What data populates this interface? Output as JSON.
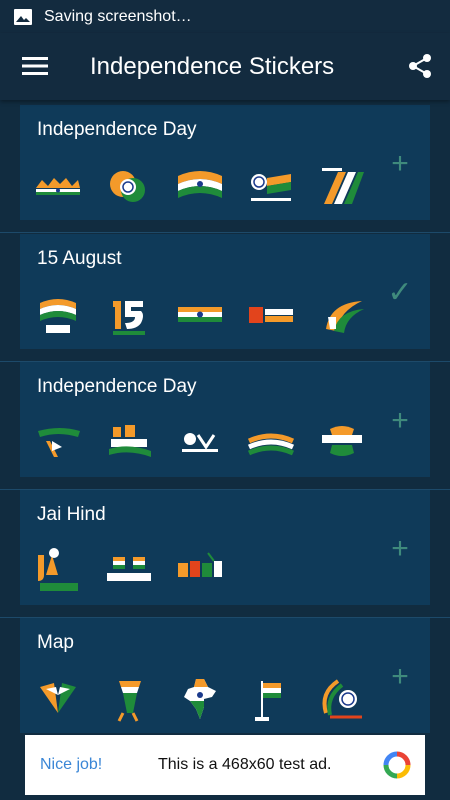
{
  "status_bar": {
    "text": "Saving screenshot…",
    "icon": "image-icon"
  },
  "app_bar": {
    "title": "Independence Stickers",
    "menu_icon": "hamburger-menu-icon",
    "share_icon": "share-icon"
  },
  "packs": [
    {
      "title": "Independence Day",
      "action": "+",
      "action_icon": "add-icon"
    },
    {
      "title": "15 August",
      "action": "✓",
      "action_icon": "check-icon"
    },
    {
      "title": "Independence Day",
      "action": "+",
      "action_icon": "add-icon"
    },
    {
      "title": "Jai Hind",
      "action": "+",
      "action_icon": "add-icon"
    },
    {
      "title": "Map",
      "action": "+",
      "action_icon": "add-icon"
    }
  ],
  "ad": {
    "left_text": "Nice job!",
    "text": "This is a 468x60 test ad.",
    "logo": "ad-logo-icon"
  },
  "colors": {
    "background": "#112c40",
    "card": "#0f3a59",
    "app_bar": "#132b3f",
    "accent_action": "#3f8a7c",
    "ad_link": "#3a86d6",
    "saffron": "#f49a2a",
    "green": "#1f8b3a",
    "navy": "#1b3a8c"
  }
}
